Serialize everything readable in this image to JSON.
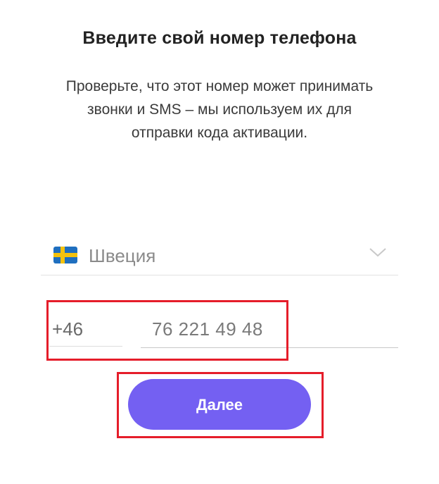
{
  "header": {
    "title": "Введите свой номер телефона",
    "subtitle": "Проверьте, что этот номер может принимать звонки и SMS – мы используем их для отправки кода активации."
  },
  "country": {
    "flag_icon": "sweden-flag-icon",
    "name": "Швеция",
    "dropdown_icon": "chevron-down-icon"
  },
  "phone": {
    "country_code": "+46",
    "number": "76 221 49 48"
  },
  "actions": {
    "next_label": "Далее",
    "accent_color": "#7460f2",
    "highlight_color": "#e51d2a"
  }
}
